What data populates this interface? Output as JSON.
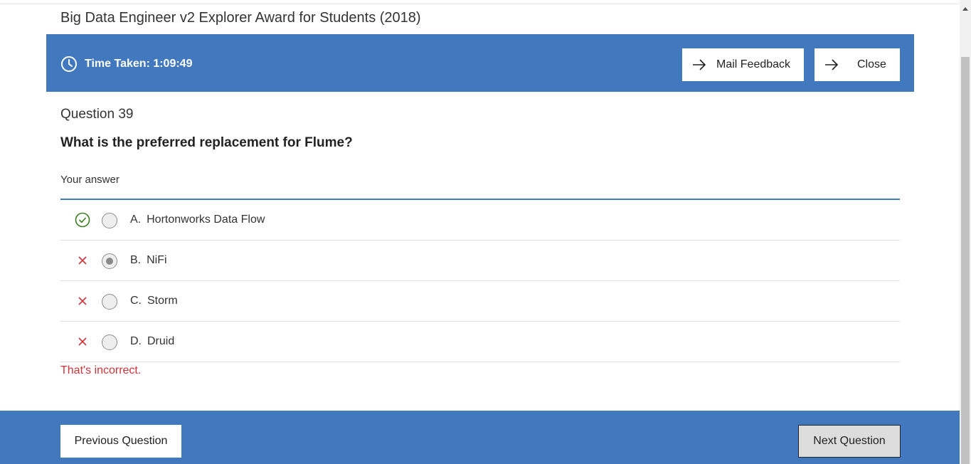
{
  "page": {
    "title": "Big Data Engineer v2 Explorer Award for Students (2018)"
  },
  "banner": {
    "timer_label": "Time Taken: 1:09:49",
    "mail_feedback_label": "Mail Feedback",
    "close_label": "Close",
    "color": "#4178be"
  },
  "question": {
    "number_label": "Question 39",
    "text": "What is the preferred replacement for Flume?",
    "your_answer_label": "Your answer",
    "options": [
      {
        "letter": "A.",
        "text": "Hortonworks Data Flow",
        "mark": "check-circle-icon",
        "selected": false,
        "correct": true
      },
      {
        "letter": "B.",
        "text": "NiFi",
        "mark": "x-icon",
        "selected": true,
        "correct": false
      },
      {
        "letter": "C.",
        "text": "Storm",
        "mark": "x-icon",
        "selected": false,
        "correct": false
      },
      {
        "letter": "D.",
        "text": "Druid",
        "mark": "x-icon",
        "selected": false,
        "correct": false
      }
    ],
    "feedback": "That's incorrect.",
    "feedback_color": "#d0333a",
    "correct_color": "#3a7d1e"
  },
  "footer": {
    "previous_label": "Previous Question",
    "next_label": "Next Question"
  }
}
